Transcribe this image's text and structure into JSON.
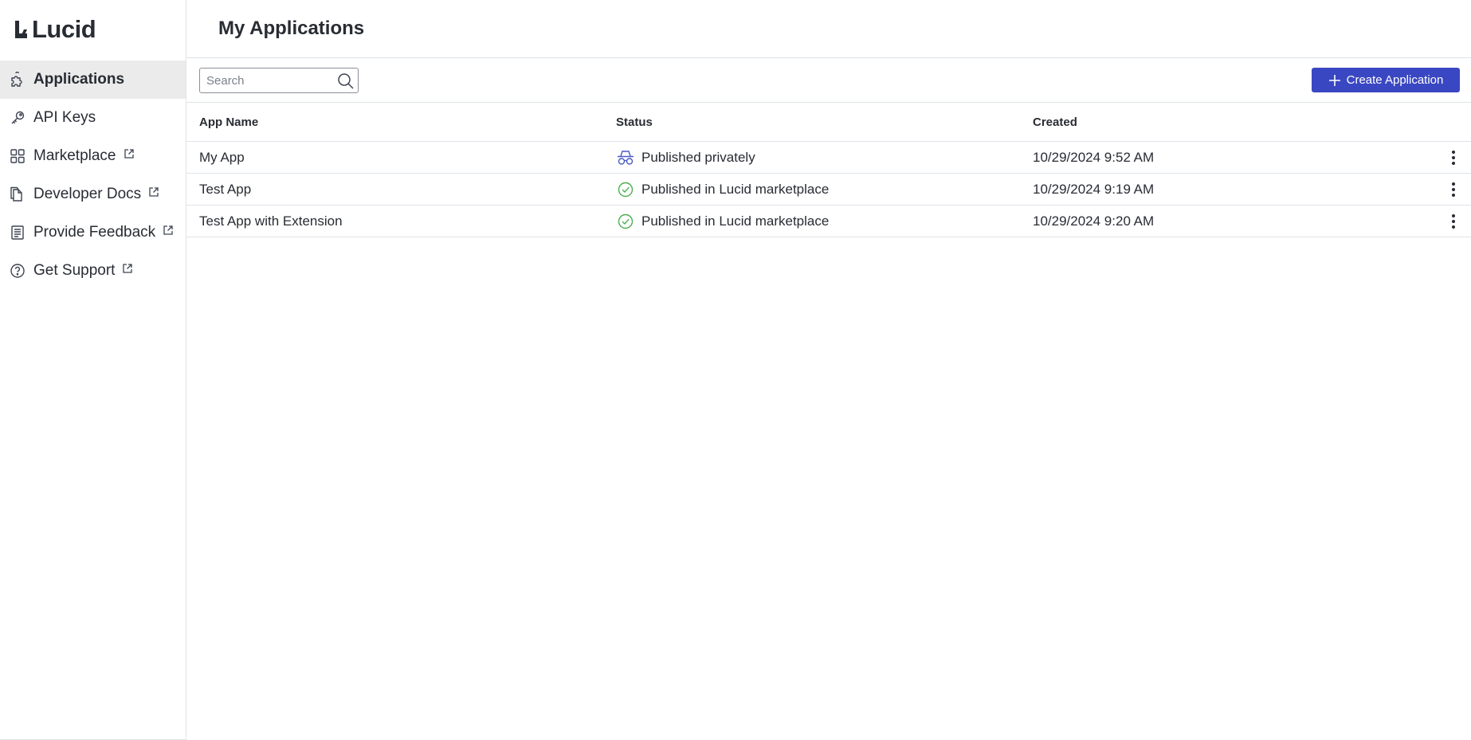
{
  "brand": {
    "name": "Lucid"
  },
  "sidebar": {
    "items": [
      {
        "label": "Applications",
        "icon": "puzzle-icon",
        "external": false,
        "active": true
      },
      {
        "label": "API Keys",
        "icon": "key-icon",
        "external": false,
        "active": false
      },
      {
        "label": "Marketplace",
        "icon": "grid-icon",
        "external": true,
        "active": false
      },
      {
        "label": "Developer Docs",
        "icon": "docs-icon",
        "external": true,
        "active": false
      },
      {
        "label": "Provide Feedback",
        "icon": "feedback-icon",
        "external": true,
        "active": false
      },
      {
        "label": "Get Support",
        "icon": "help-icon",
        "external": true,
        "active": false
      }
    ]
  },
  "main": {
    "title": "My Applications",
    "search": {
      "placeholder": "Search",
      "value": ""
    },
    "create_button": {
      "label": "Create Application"
    },
    "table": {
      "columns": [
        "App Name",
        "Status",
        "Created"
      ],
      "rows": [
        {
          "name": "My App",
          "status": "Published privately",
          "status_icon": "incognito-icon",
          "created": "10/29/2024 9:52 AM"
        },
        {
          "name": "Test App",
          "status": "Published in Lucid marketplace",
          "status_icon": "check-circle-icon",
          "created": "10/29/2024 9:19 AM"
        },
        {
          "name": "Test App with Extension",
          "status": "Published in Lucid marketplace",
          "status_icon": "check-circle-icon",
          "created": "10/29/2024 9:20 AM"
        }
      ]
    }
  },
  "colors": {
    "accent": "#3a47c2",
    "success": "#4caf50",
    "private": "#4a5bc4",
    "active_bg": "#ebebeb",
    "divider": "#dfe3e8"
  }
}
